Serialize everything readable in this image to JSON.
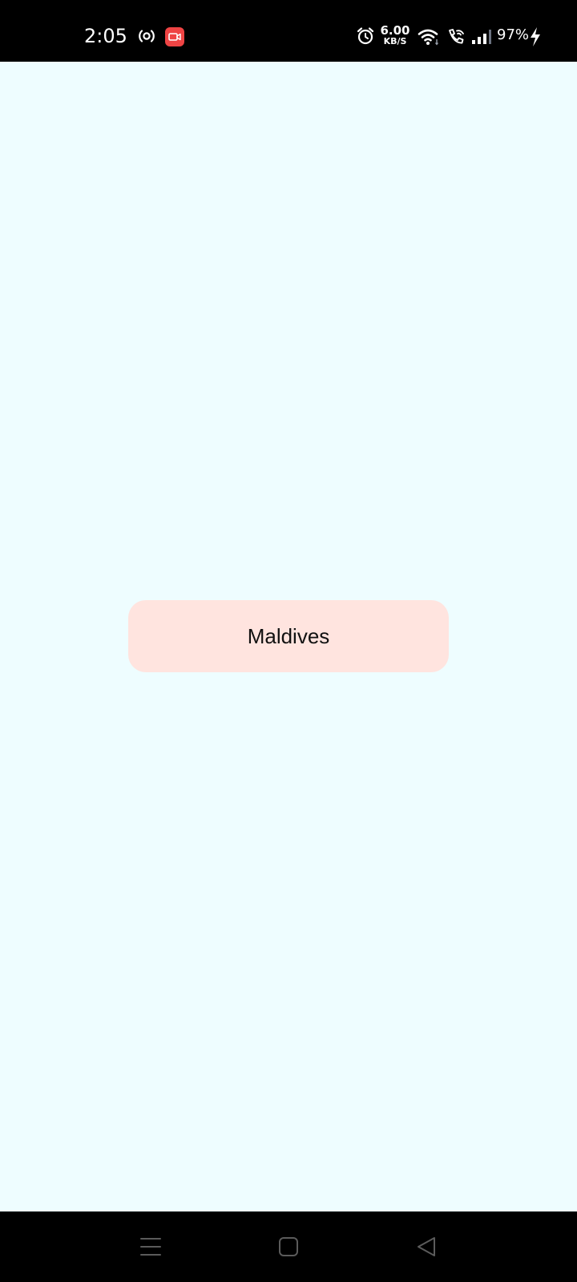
{
  "status_bar": {
    "time": "2:05",
    "net_speed_value": "6.00",
    "net_speed_unit": "KB/S",
    "battery_percent": "97%",
    "icons": [
      "hotspot-icon",
      "screen-record-icon",
      "alarm-icon",
      "wifi-icon",
      "wifi-calling-icon",
      "signal-icon",
      "charging-icon"
    ],
    "record_badge_color": "#ef4444"
  },
  "main": {
    "button_label": "Maldives",
    "background_color": "#eefdff",
    "button_color": "#ffe4df"
  },
  "nav_bar": {
    "icons": [
      "menu-icon",
      "home-icon",
      "back-icon"
    ]
  }
}
